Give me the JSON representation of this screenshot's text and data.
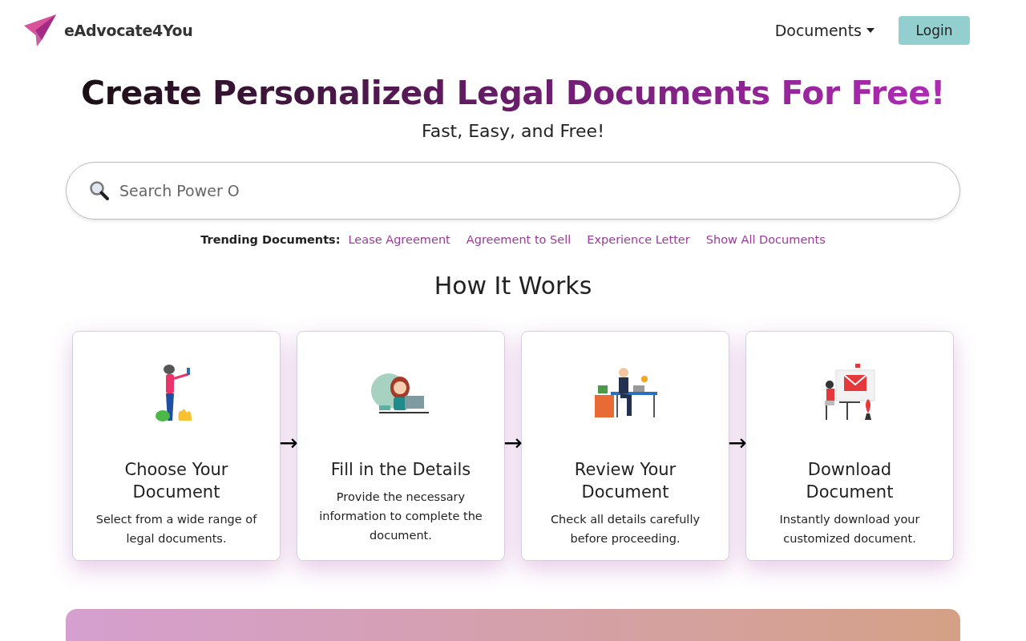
{
  "header": {
    "brand": "eAdvocate4You",
    "nav": [
      {
        "label": "Documents",
        "kind": "dropdown"
      },
      {
        "label": "Login",
        "kind": "button"
      }
    ]
  },
  "hero": {
    "title": "Create Personalized Legal Documents For Free!",
    "subtitle": "Fast, Easy, and Free!"
  },
  "search": {
    "placeholder": "Search Power O"
  },
  "trending": {
    "label": "Trending Documents:",
    "links": [
      "Lease Agreement",
      "Agreement to Sell",
      "Experience Letter",
      "Show All Documents"
    ]
  },
  "how_it_works": {
    "heading": "How It Works",
    "arrow": "→",
    "steps": [
      {
        "title": "Choose Your Document",
        "description": "Select from a wide range of legal documents."
      },
      {
        "title": "Fill in the Details",
        "description": "Provide the necessary information to complete the document."
      },
      {
        "title": "Review Your Document",
        "description": "Check all details carefully before proceeding."
      },
      {
        "title": "Download Document",
        "description": "Instantly download your customized document."
      }
    ]
  }
}
